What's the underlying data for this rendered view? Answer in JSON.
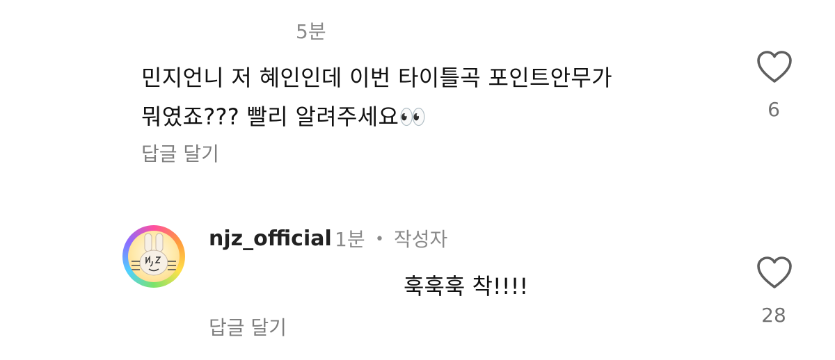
{
  "comment1": {
    "time": "5분",
    "text_line1": "민지언니 저 혜인인데 이번 타이틀곡 포인트안무가",
    "text_line2": "뭐였죠??? 빨리 알려주세요👀",
    "reply_label": "답글 달기",
    "like_count": "6"
  },
  "comment2": {
    "username": "njz_official",
    "time": "1분",
    "separator": "•",
    "author_badge": "작성자",
    "text": "훅훅훅 착!!!!",
    "reply_label": "답글 달기",
    "like_count": "28"
  },
  "icons": {
    "like": "heart-outline-icon",
    "avatar": "bunny-face-icon"
  },
  "colors": {
    "text": "#111111",
    "secondary": "#8a8a8a",
    "heart_stroke": "#5f5f5f"
  }
}
